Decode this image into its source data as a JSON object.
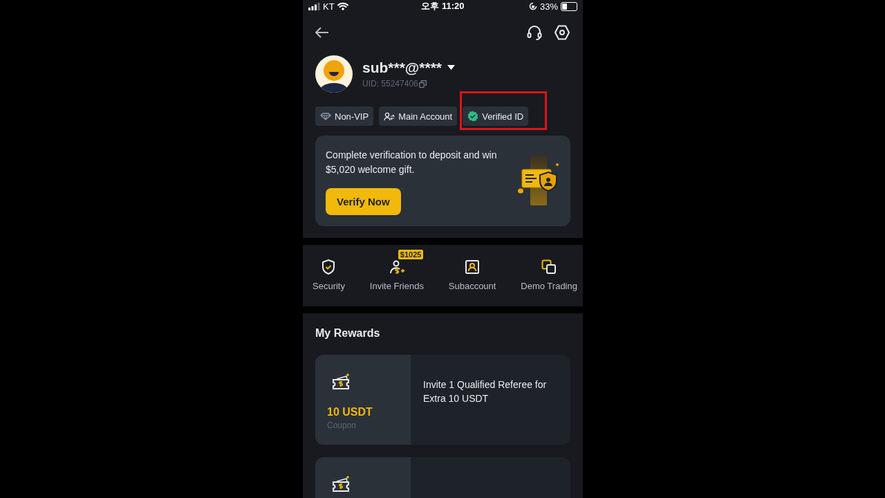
{
  "status_bar": {
    "carrier": "KT",
    "time": "오후 11:20",
    "battery": "33%"
  },
  "profile": {
    "name": "sub***@****",
    "uid": "UID: 55247406"
  },
  "badges": [
    {
      "kind": "vip",
      "label": "Non-VIP",
      "highlighted": false
    },
    {
      "kind": "account",
      "label": "Main Account",
      "highlighted": false
    },
    {
      "kind": "verified",
      "label": "Verified ID",
      "highlighted": true
    }
  ],
  "promo": {
    "text": "Complete verification to deposit and win $5,020 welcome gift.",
    "button": "Verify Now"
  },
  "shortcuts": [
    {
      "kind": "security",
      "label": "Security"
    },
    {
      "kind": "invite",
      "label": "Invite Friends",
      "badge": "$1025"
    },
    {
      "kind": "subaccount",
      "label": "Subaccount"
    },
    {
      "kind": "demo",
      "label": "Demo Trading"
    }
  ],
  "rewards": {
    "title": "My Rewards",
    "cards": [
      {
        "kind": "coupon",
        "amount": "10 USDT",
        "type": "Coupon",
        "description": "Invite 1 Qualified Referee for Extra 10 USDT"
      },
      {
        "kind": "coupon"
      }
    ]
  }
}
